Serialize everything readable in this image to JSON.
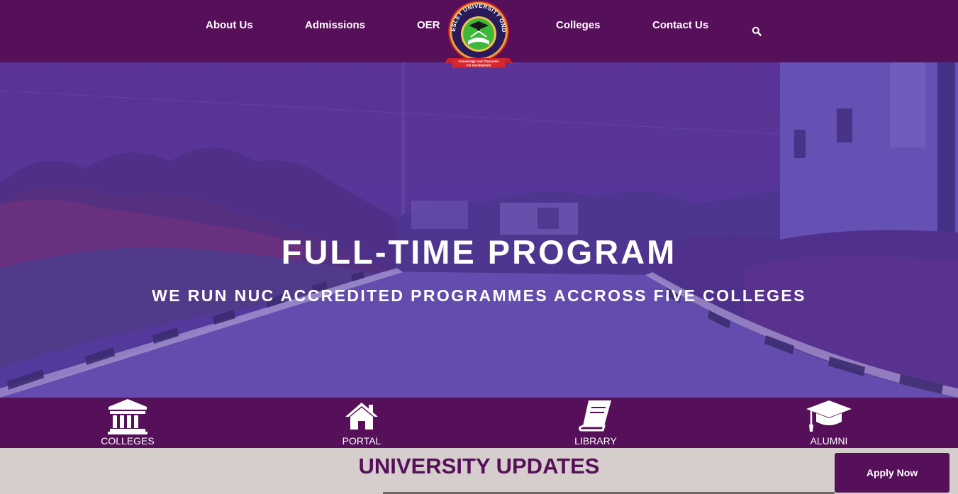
{
  "nav": {
    "items": [
      {
        "label": "About Us"
      },
      {
        "label": "Admissions"
      },
      {
        "label": "OER"
      },
      {
        "label": "Colleges"
      },
      {
        "label": "Contact Us"
      }
    ],
    "search_icon": "search-icon"
  },
  "logo": {
    "name": "WESLEY UNIVERSITY ONDO",
    "motto": "Knowledge and Character For Development"
  },
  "hero": {
    "title": "FULL-TIME PROGRAM",
    "subtitle": "WE RUN NUC ACCREDITED PROGRAMMES ACCROSS FIVE COLLEGES",
    "overlay_color": "#5a3a9e"
  },
  "quicklinks": [
    {
      "label": "COLLEGES",
      "icon": "building-icon"
    },
    {
      "label": "PORTAL",
      "icon": "home-icon"
    },
    {
      "label": "LIBRARY",
      "icon": "book-icon"
    },
    {
      "label": "ALUMNI",
      "icon": "graduation-cap-icon"
    }
  ],
  "updates": {
    "title": "UNIVERSITY UPDATES"
  },
  "apply_button": {
    "label": "Apply Now"
  },
  "colors": {
    "brand_purple": "#551059",
    "updates_bg": "#d6cdcd"
  }
}
